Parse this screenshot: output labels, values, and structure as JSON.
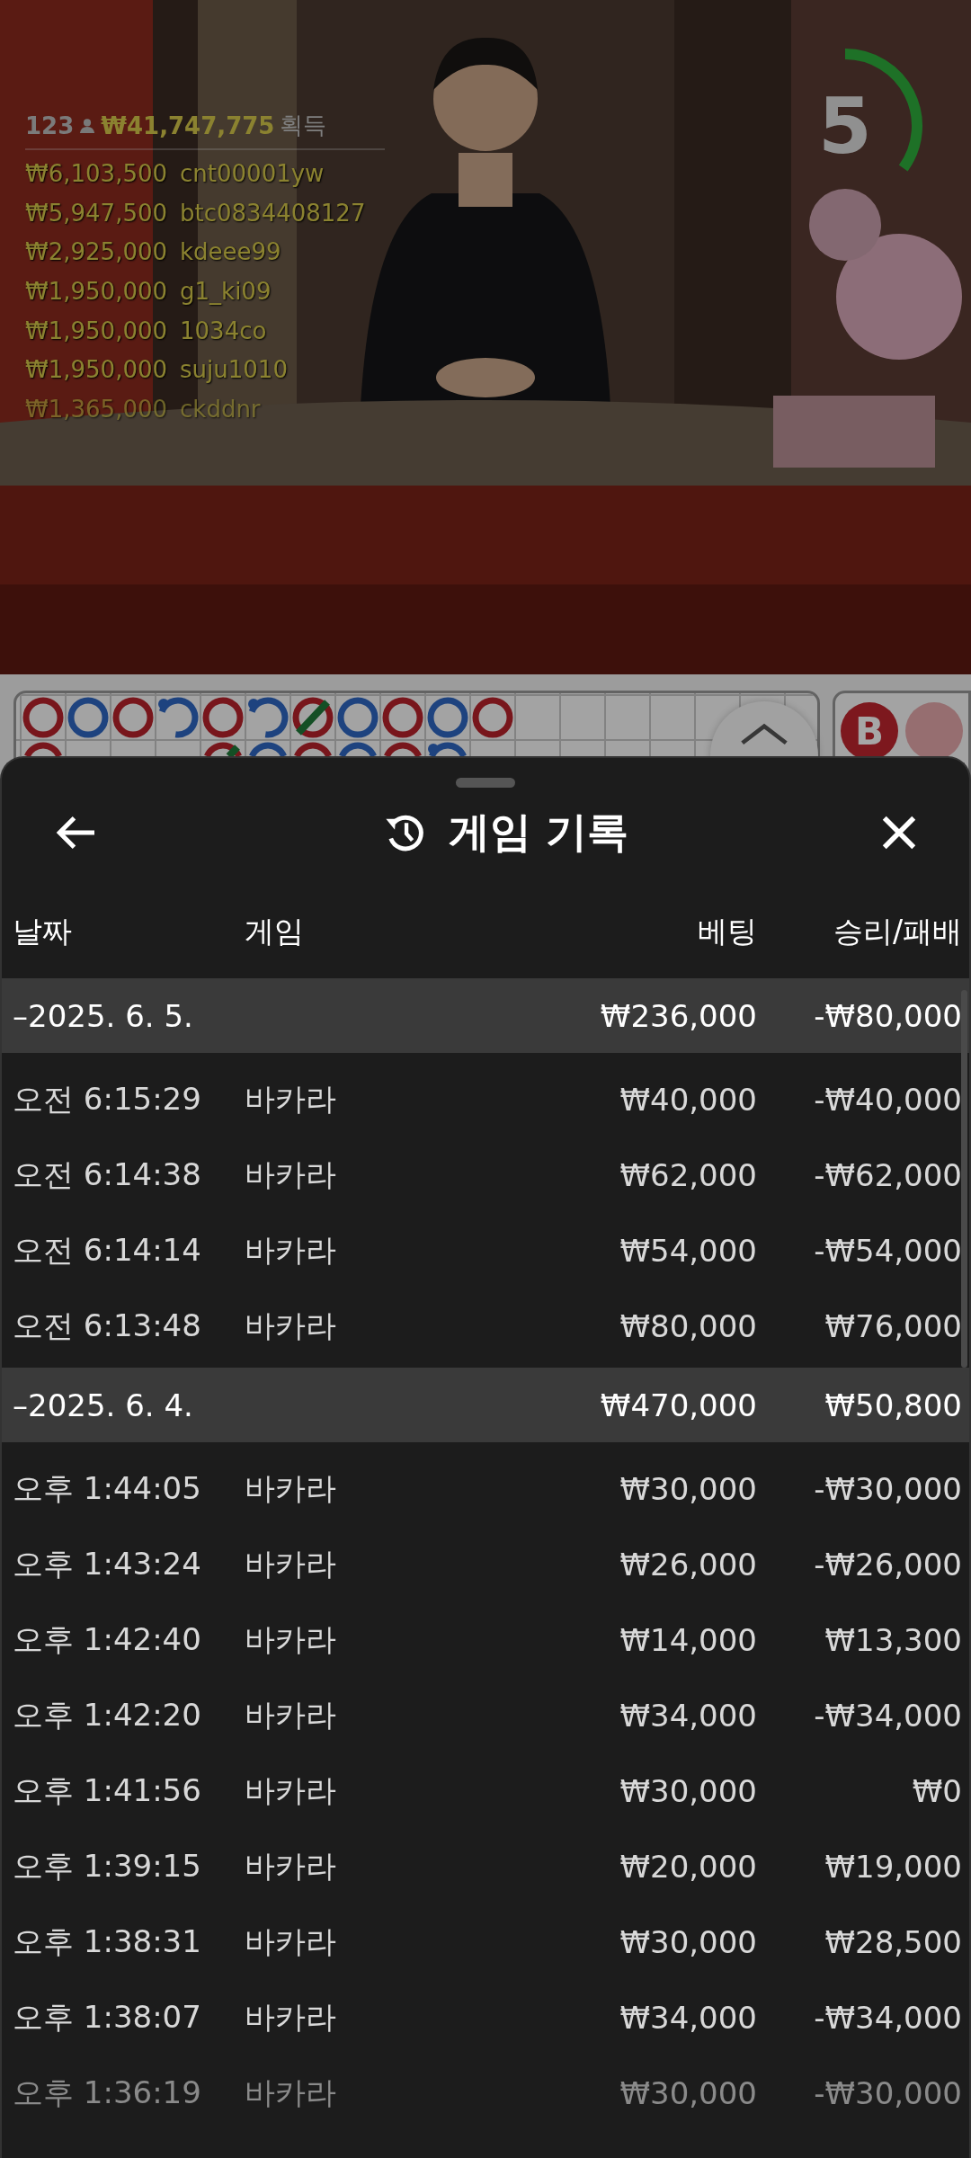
{
  "leaderboard": {
    "players": "123",
    "total": "₩41,747,775",
    "label": "획득",
    "entries": [
      {
        "amount": "₩6,103,500",
        "user": "cnt00001yw"
      },
      {
        "amount": "₩5,947,500",
        "user": "btc0834408127"
      },
      {
        "amount": "₩2,925,000",
        "user": "kdeee99"
      },
      {
        "amount": "₩1,950,000",
        "user": "g1_ki09"
      },
      {
        "amount": "₩1,950,000",
        "user": "1034co"
      },
      {
        "amount": "₩1,950,000",
        "user": "suju1010"
      },
      {
        "amount": "₩1,365,000",
        "user": "ckddnr"
      }
    ]
  },
  "timer": {
    "value": "5"
  },
  "road": {
    "rows": [
      [
        {
          "kind": "banker",
          "pair": false,
          "tie": false
        },
        {
          "kind": "player",
          "pair": false,
          "tie": false
        },
        {
          "kind": "banker",
          "pair": false,
          "tie": false
        },
        {
          "kind": "player",
          "pair": true,
          "tie": false
        },
        {
          "kind": "banker",
          "pair": false,
          "tie": false
        },
        {
          "kind": "player",
          "pair": true,
          "tie": false
        },
        {
          "kind": "banker",
          "pair": false,
          "tie": true
        },
        {
          "kind": "player",
          "pair": false,
          "tie": false
        },
        {
          "kind": "banker",
          "pair": false,
          "tie": false
        },
        {
          "kind": "player",
          "pair": false,
          "tie": false
        },
        {
          "kind": "banker",
          "pair": false,
          "tie": false
        }
      ],
      [
        {
          "kind": "banker",
          "pair": false,
          "tie": false
        },
        {
          "kind": "empty"
        },
        {
          "kind": "empty"
        },
        {
          "kind": "empty"
        },
        {
          "kind": "banker",
          "pair": false,
          "tie": true
        },
        {
          "kind": "player",
          "pair": false,
          "tie": false
        },
        {
          "kind": "banker",
          "pair": false,
          "tie": false
        },
        {
          "kind": "player",
          "pair": false,
          "tie": false
        },
        {
          "kind": "banker",
          "pair": false,
          "tie": false
        },
        {
          "kind": "player",
          "pair": true,
          "tie": false
        }
      ]
    ],
    "side_label": "B"
  },
  "sheet": {
    "title": "게임 기록",
    "columns": [
      "날짜",
      "게임",
      "베팅",
      "승리/패배"
    ],
    "groups": [
      {
        "date": "–2025. 6. 5.",
        "bet": "₩236,000",
        "result": "-₩80,000",
        "rows": [
          {
            "time": "오전 6:15:29",
            "game": "바카라",
            "bet": "₩40,000",
            "result": "-₩40,000"
          },
          {
            "time": "오전 6:14:38",
            "game": "바카라",
            "bet": "₩62,000",
            "result": "-₩62,000"
          },
          {
            "time": "오전 6:14:14",
            "game": "바카라",
            "bet": "₩54,000",
            "result": "-₩54,000"
          },
          {
            "time": "오전 6:13:48",
            "game": "바카라",
            "bet": "₩80,000",
            "result": "₩76,000"
          }
        ]
      },
      {
        "date": "–2025. 6. 4.",
        "bet": "₩470,000",
        "result": "₩50,800",
        "rows": [
          {
            "time": "오후 1:44:05",
            "game": "바카라",
            "bet": "₩30,000",
            "result": "-₩30,000"
          },
          {
            "time": "오후 1:43:24",
            "game": "바카라",
            "bet": "₩26,000",
            "result": "-₩26,000"
          },
          {
            "time": "오후 1:42:40",
            "game": "바카라",
            "bet": "₩14,000",
            "result": "₩13,300"
          },
          {
            "time": "오후 1:42:20",
            "game": "바카라",
            "bet": "₩34,000",
            "result": "-₩34,000"
          },
          {
            "time": "오후 1:41:56",
            "game": "바카라",
            "bet": "₩30,000",
            "result": "₩0"
          },
          {
            "time": "오후 1:39:15",
            "game": "바카라",
            "bet": "₩20,000",
            "result": "₩19,000"
          },
          {
            "time": "오후 1:38:31",
            "game": "바카라",
            "bet": "₩30,000",
            "result": "₩28,500"
          },
          {
            "time": "오후 1:38:07",
            "game": "바카라",
            "bet": "₩34,000",
            "result": "-₩34,000"
          },
          {
            "time": "오후 1:36:19",
            "game": "바카라",
            "bet": "₩30,000",
            "result": "-₩30,000"
          }
        ]
      }
    ]
  }
}
